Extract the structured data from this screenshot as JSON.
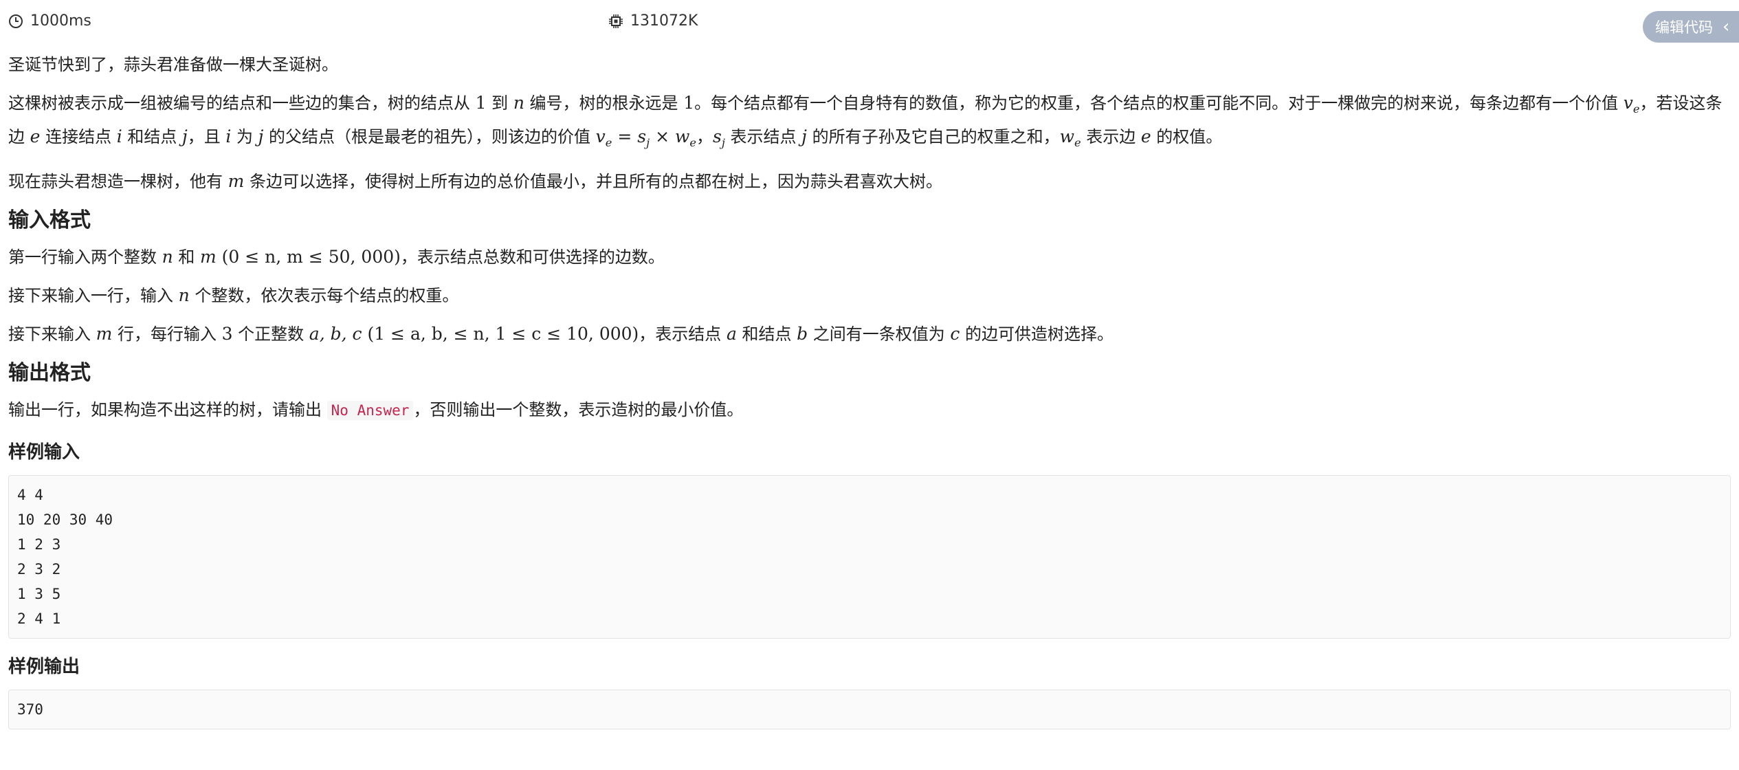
{
  "meta": {
    "time_limit": "1000ms",
    "memory_limit": "131072K",
    "edit_button_label": "编辑代码",
    "collapse_chevron": "‹"
  },
  "problem": {
    "p1": "圣诞节快到了，蒜头君准备做一棵大圣诞树。",
    "p2": {
      "t1": "这棵树被表示成一组被编号的结点和一些边的集合，树的结点从 ",
      "m1": "1",
      "t2": " 到 ",
      "m2": "n",
      "t3": " 编号，树的根永远是 ",
      "m3": "1",
      "t4": "。每个结点都有一个自身特有的数值，称为它的权重，各个结点的权重可能不同。对于一棵做完的树来说，每条边都有一个价值 ",
      "m4": "v",
      "m4sub": "e",
      "t5": "，若设这条边 ",
      "m5": "e",
      "t6": " 连接结点 ",
      "m6": "i",
      "t7": " 和结点 ",
      "m7": "j",
      "t8": "，且 ",
      "m8": "i",
      "t9": " 为 ",
      "m9": "j",
      "t10": " 的父结点（根是最老的祖先），则该边的价值 ",
      "m10a": "v",
      "m10asub": "e",
      "m10b": " = s",
      "m10bsub": "j",
      "m10c": " × w",
      "m10csub": "e",
      "t11": "，",
      "m11": "s",
      "m11sub": "j",
      "t12": " 表示结点 ",
      "m12": "j",
      "t13": " 的所有子孙及它自己的权重之和，",
      "m13": "w",
      "m13sub": "e",
      "t14": " 表示边 ",
      "m14": "e",
      "t15": " 的权值。"
    },
    "p3": {
      "t1": "现在蒜头君想造一棵树，他有 ",
      "m1": "m",
      "t2": " 条边可以选择，使得树上所有边的总价值最小，并且所有的点都在树上，因为蒜头君喜欢大树。"
    },
    "input_heading": "输入格式",
    "in1": {
      "t1": "第一行输入两个整数 ",
      "m1": "n",
      "t2": " 和 ",
      "m2": "m",
      "m3": " (0 ≤ n, m ≤ 50, 000)",
      "t3": "，表示结点总数和可供选择的边数。"
    },
    "in2": {
      "t1": "接下来输入一行，输入 ",
      "m1": "n",
      "t2": " 个整数，依次表示每个结点的权重。"
    },
    "in3": {
      "t1": "接下来输入 ",
      "m1": "m",
      "t2": " 行，每行输入 ",
      "m2": "3",
      "t3": " 个正整数 ",
      "m3": "a, b, c",
      "m4": " (1 ≤ a, b, ≤ n, 1 ≤ c ≤ 10, 000)",
      "t4": "，表示结点 ",
      "m5": "a",
      "t5": " 和结点 ",
      "m6": "b",
      "t6": " 之间有一条权值为 ",
      "m7": "c",
      "t7": " 的边可供造树选择。"
    },
    "output_heading": "输出格式",
    "out1": {
      "t1": "输出一行，如果构造不出这样的树，请输出 ",
      "code": "No Answer",
      "t2": "，否则输出一个整数，表示造树的最小价值。"
    },
    "sample_input_heading": "样例输入",
    "sample_input_lines": [
      "4 4",
      "10 20 30 40",
      "1 2 3",
      "2 3 2",
      "1 3 5",
      "2 4 1"
    ],
    "sample_output_heading": "样例输出",
    "sample_output_lines": [
      "370"
    ]
  }
}
